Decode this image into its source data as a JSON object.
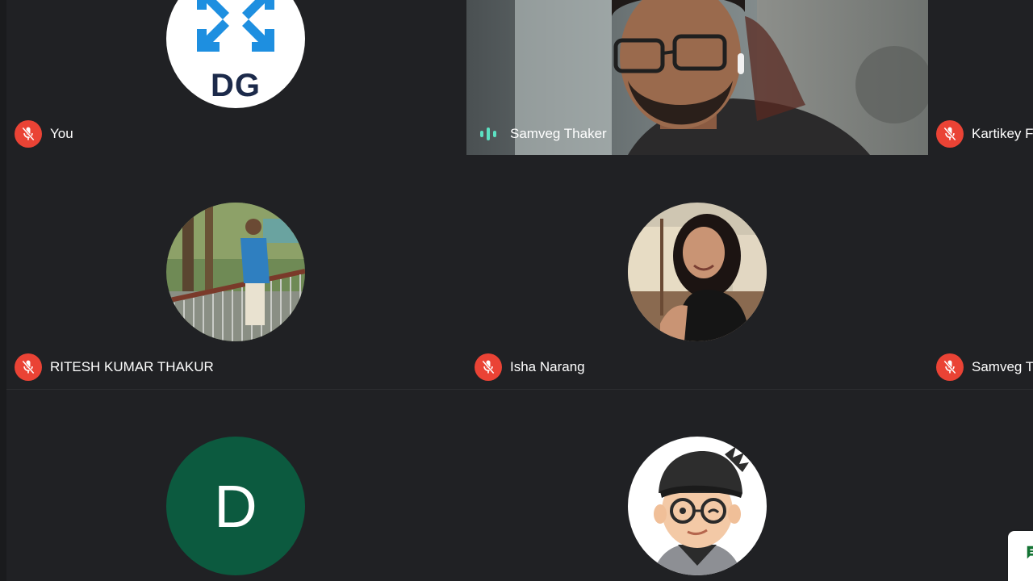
{
  "participants": [
    {
      "name": "You",
      "muted": true,
      "avatar_text": "DG",
      "avatar_type": "logo"
    },
    {
      "name": "Samveg Thaker",
      "muted": false,
      "speaking": true,
      "avatar_type": "video"
    },
    {
      "name": "Kartikey F",
      "muted": true
    },
    {
      "name": "RITESH KUMAR THAKUR",
      "muted": true,
      "avatar_type": "photo"
    },
    {
      "name": "Isha Narang",
      "muted": true,
      "avatar_type": "photo"
    },
    {
      "name": "Samveg T",
      "muted": true
    },
    {
      "name": "",
      "avatar_text": "D",
      "avatar_type": "initial"
    },
    {
      "name": "",
      "avatar_type": "cartoon"
    }
  ],
  "colors": {
    "background": "#202124",
    "muted_badge": "#ea4335",
    "speaking_indicator": "#5ce1c2",
    "initial_avatar": "#0c5a3f",
    "logo_blue": "#1e8fe0",
    "logo_text": "#1c2a4a"
  },
  "icons": {
    "muted": "mic-off-icon",
    "speaking": "audio-level-icon",
    "chat": "chat-icon"
  }
}
